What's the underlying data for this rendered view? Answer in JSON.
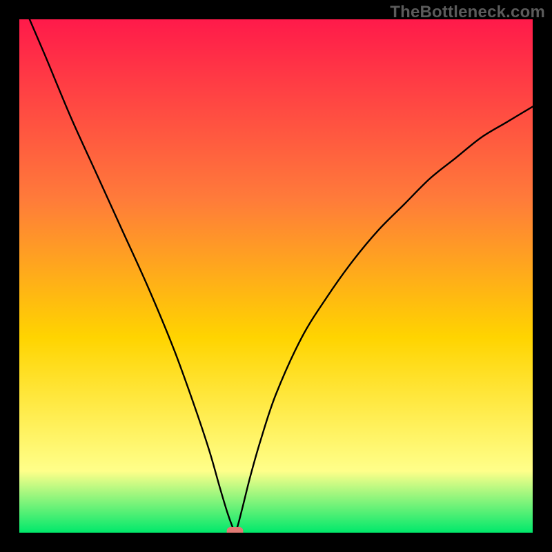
{
  "watermark": "TheBottleneck.com",
  "chart_data": {
    "type": "line",
    "title": "",
    "xlabel": "",
    "ylabel": "",
    "xlim": [
      0,
      100
    ],
    "ylim": [
      0,
      100
    ],
    "grid": false,
    "legend": false,
    "background_gradient": {
      "top_color": "#ff1a4a",
      "mid_color_1": "#ff7b3a",
      "mid_color_2": "#ffd400",
      "low_color": "#ffff8a",
      "bottom_color": "#00e86b",
      "stops": [
        0,
        35,
        62,
        88,
        100
      ]
    },
    "series": [
      {
        "name": "bottleneck-curve",
        "color": "#000000",
        "x": [
          2,
          5,
          10,
          15,
          20,
          25,
          30,
          34,
          37,
          39,
          40.5,
          41.5,
          42,
          42.5,
          43.5,
          45,
          47,
          50,
          55,
          60,
          65,
          70,
          75,
          80,
          85,
          90,
          95,
          100
        ],
        "y": [
          100,
          93,
          81,
          70,
          59,
          48,
          36,
          25,
          16,
          9,
          4,
          1.2,
          0.2,
          1.2,
          5,
          11,
          18,
          27,
          38,
          46,
          53,
          59,
          64,
          69,
          73,
          77,
          80,
          83
        ]
      }
    ],
    "marker": {
      "name": "optimal-marker",
      "shape": "rounded-rect",
      "color": "#e07a74",
      "x": 42,
      "y": 0,
      "width_pct": 3.2,
      "height_pct": 1.6
    }
  }
}
